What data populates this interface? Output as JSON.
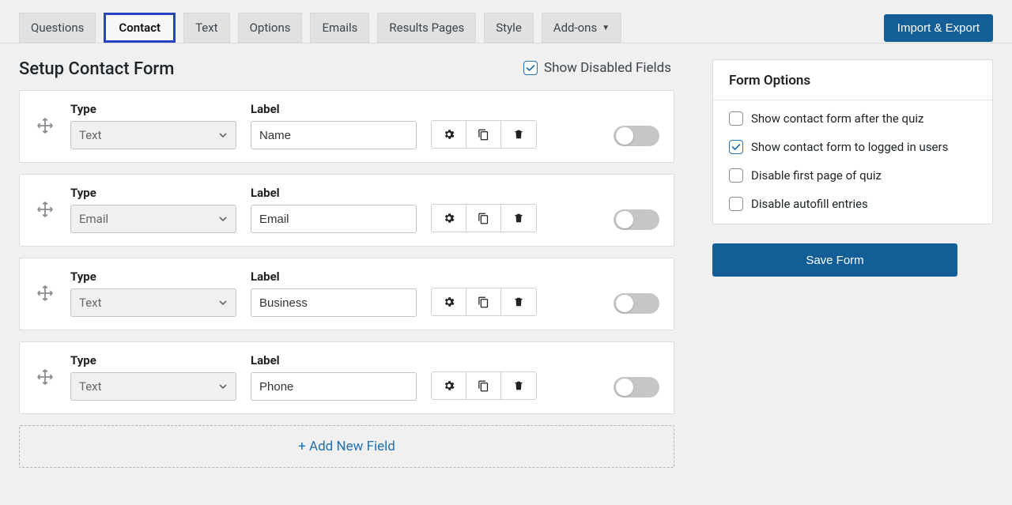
{
  "tabs": {
    "items": [
      {
        "label": "Questions"
      },
      {
        "label": "Contact"
      },
      {
        "label": "Text"
      },
      {
        "label": "Options"
      },
      {
        "label": "Emails"
      },
      {
        "label": "Results Pages"
      },
      {
        "label": "Style"
      },
      {
        "label": "Add-ons"
      }
    ],
    "active_index": 1
  },
  "import_export_label": "Import & Export",
  "section_title": "Setup Contact Form",
  "show_disabled": {
    "label": "Show Disabled Fields",
    "checked": true
  },
  "field_headers": {
    "type": "Type",
    "label": "Label"
  },
  "fields": [
    {
      "type": "Text",
      "label": "Name",
      "enabled": false
    },
    {
      "type": "Email",
      "label": "Email",
      "enabled": false
    },
    {
      "type": "Text",
      "label": "Business",
      "enabled": false
    },
    {
      "type": "Text",
      "label": "Phone",
      "enabled": false
    }
  ],
  "add_new_label": "+ Add New Field",
  "sidebar": {
    "panel_title": "Form Options",
    "options": [
      {
        "label": "Show contact form after the quiz",
        "checked": false
      },
      {
        "label": "Show contact form to logged in users",
        "checked": true
      },
      {
        "label": "Disable first page of quiz",
        "checked": false
      },
      {
        "label": "Disable autofill entries",
        "checked": false
      }
    ],
    "save_label": "Save Form"
  },
  "icons": {
    "gear": "gear-icon",
    "copy": "copy-icon",
    "trash": "trash-icon",
    "move": "move-icon",
    "chevron_down": "chevron-down-icon"
  }
}
